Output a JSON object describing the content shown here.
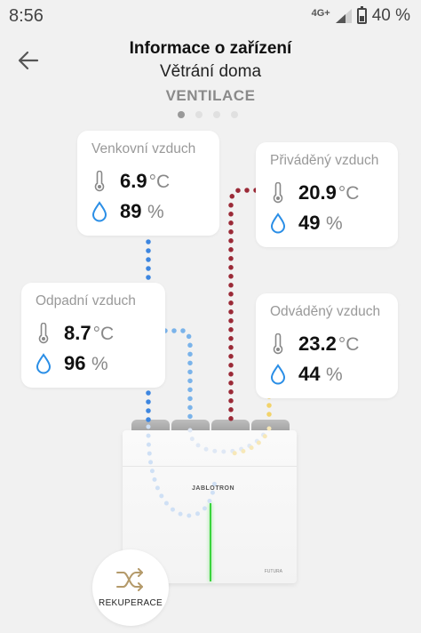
{
  "status_bar": {
    "time": "8:56",
    "network": "4G+",
    "battery": "40 %"
  },
  "header": {
    "title": "Informace o zařízení",
    "subtitle": "Větrání doma",
    "mode": "VENTILACE"
  },
  "pager": {
    "pages": 4,
    "active": 0
  },
  "cards": {
    "outdoor": {
      "label": "Venkovní vzduch",
      "temperature": "6.9",
      "temp_unit": "°C",
      "humidity": "89",
      "hum_unit": "%"
    },
    "supply": {
      "label": "Přiváděný vzduch",
      "temperature": "20.9",
      "temp_unit": "°C",
      "humidity": "49",
      "hum_unit": "%"
    },
    "extract": {
      "label": "Odpadní vzduch",
      "temperature": "8.7",
      "temp_unit": "°C",
      "humidity": "96",
      "hum_unit": "%"
    },
    "exhaust": {
      "label": "Odváděný vzduch",
      "temperature": "23.2",
      "temp_unit": "°C",
      "humidity": "44",
      "hum_unit": "%"
    }
  },
  "device": {
    "brand": "JABLOTRON",
    "model": "FUTURA"
  },
  "mode_button": {
    "label": "REKUPERACE",
    "icon": "shuffle-icon"
  },
  "colors": {
    "cold_flow": "#3d86e0",
    "warm_flow": "#9b2a37",
    "exhaust_flow": "#f2d36b",
    "thermo": "#888888",
    "humidity": "#2a8ee6",
    "led": "#39d33c"
  }
}
